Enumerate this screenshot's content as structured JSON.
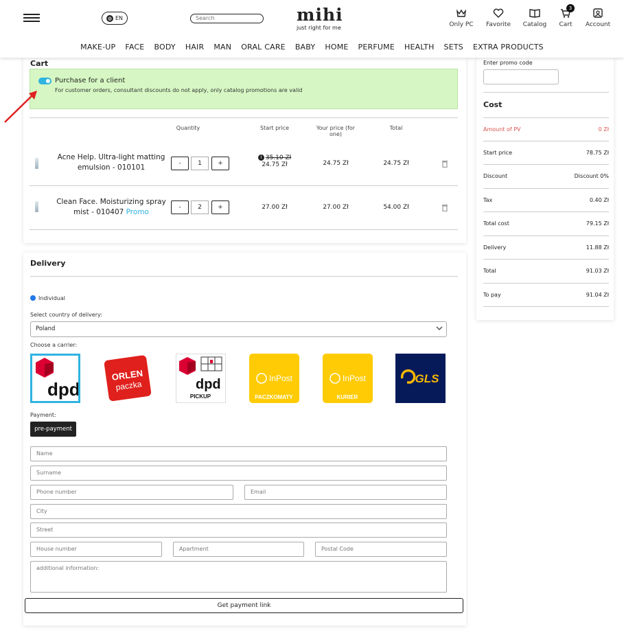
{
  "header": {
    "lang": "EN",
    "search_placeholder": "Search",
    "logo": "mihi",
    "tagline": "just right for me",
    "icons": [
      {
        "label": "Only PC",
        "icon": "crown-icon"
      },
      {
        "label": "Favorite",
        "icon": "heart-icon"
      },
      {
        "label": "Catalog",
        "icon": "book-icon"
      },
      {
        "label": "Cart",
        "icon": "cart-icon",
        "badge": "3"
      },
      {
        "label": "Account",
        "icon": "user-icon"
      }
    ]
  },
  "nav": [
    "MAKE-UP",
    "FACE",
    "BODY",
    "HAIR",
    "MAN",
    "ORAL CARE",
    "BABY",
    "HOME",
    "PERFUME",
    "HEALTH",
    "SETS",
    "EXTRA PRODUCTS"
  ],
  "cart": {
    "title": "Cart",
    "client_toggle_label": "Purchase for a client",
    "client_note": "For customer orders, consultant discounts do not apply, only catalog promotions are valid",
    "columns": {
      "quantity": "Quantity",
      "start_price": "Start price",
      "your_price": "Your price (for one)",
      "total": "Total"
    },
    "items": [
      {
        "name": "Acne Help. Ultra-light matting emulsion - 010101",
        "promo": "",
        "qty": "1",
        "old_price": "35.10 Zł",
        "start_price": "24.75 Zł",
        "your_price": "24.75 Zł",
        "total": "24.75 Zł"
      },
      {
        "name": "Clean Face. Moisturizing spray mist - 010407",
        "promo": "Promo",
        "qty": "2",
        "old_price": "",
        "start_price": "27.00 Zł",
        "your_price": "27.00 Zł",
        "total": "54.00 Zł"
      }
    ],
    "minus": "-",
    "plus": "+"
  },
  "cost": {
    "promo_label": "Enter promo code",
    "title": "Cost",
    "rows": [
      {
        "label": "Amount of PV",
        "value": "0 Zł"
      },
      {
        "label": "Start price",
        "value": "78.75 Zł"
      },
      {
        "label": "Discount",
        "value": "Discount 0%"
      },
      {
        "label": "Tax",
        "value": "0.40 Zł"
      },
      {
        "label": "Total cost",
        "value": "79.15 Zł"
      },
      {
        "label": "Delivery",
        "value": "11.88 Zł"
      },
      {
        "label": "Total",
        "value": "91.03 Zł"
      },
      {
        "label": "To pay",
        "value": "91.04 Zł"
      }
    ],
    "accent_red": "#d9534f"
  },
  "delivery": {
    "title": "Delivery",
    "individual": "Individual",
    "country_label": "Select country of delivery:",
    "country": "Poland",
    "carrier_label": "Choose a carrier:",
    "carriers": [
      {
        "name": "dpd",
        "selected": true
      },
      {
        "name": "ORLEN paczka",
        "line1": "ORLEN",
        "line2": "paczka"
      },
      {
        "name": "dpd PICKUP",
        "line1": "dpd",
        "line2": "PICKUP"
      },
      {
        "name": "InPost PACZKOMATY",
        "line1": "InPost",
        "line2": "PACZKOMATY"
      },
      {
        "name": "InPost KURIER",
        "line1": "InPost",
        "line2": "KURIER"
      },
      {
        "name": "GLS"
      }
    ],
    "payment_label": "Payment:",
    "payment_button": "pre-payment",
    "fields": {
      "name": "Name",
      "surname": "Surname",
      "phone": "Phone number",
      "email": "Email",
      "city": "City",
      "street": "Street",
      "house": "House number",
      "apartment": "Apartment",
      "postal": "Postal Code",
      "additional": "additional information:"
    },
    "submit": "Get payment link",
    "accent_blue": "#2fb3e0"
  }
}
